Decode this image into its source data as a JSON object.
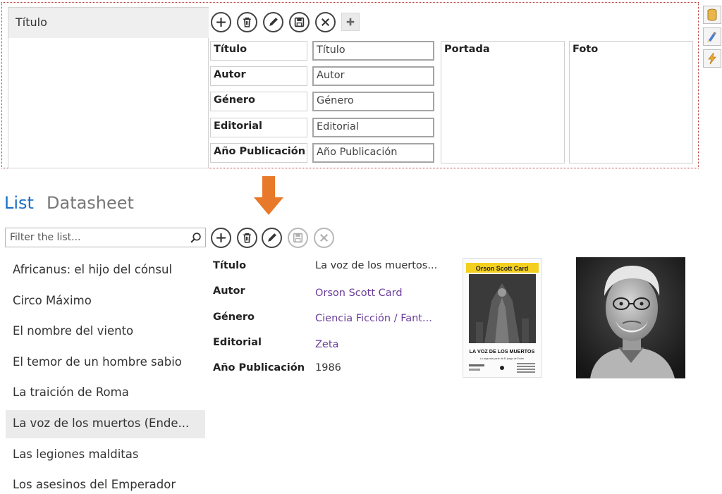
{
  "designer": {
    "title_column_header": "Título",
    "fields": [
      {
        "label": "Título",
        "placeholder": "Título"
      },
      {
        "label": "Autor",
        "placeholder": "Autor"
      },
      {
        "label": "Género",
        "placeholder": "Género"
      },
      {
        "label": "Editorial",
        "placeholder": "Editorial"
      },
      {
        "label": "Año Publicación",
        "placeholder": "Año Publicación"
      }
    ],
    "portada_label": "Portada",
    "foto_label": "Foto"
  },
  "view": {
    "tab_list": "List",
    "tab_datasheet": "Datasheet",
    "filter_placeholder": "Filter the list..."
  },
  "list": [
    "Africanus: el hijo del cónsul",
    "Circo Máximo",
    "El nombre del viento",
    "El temor de un hombre sabio",
    "La traición de Roma",
    "La voz de los muertos (Ende...",
    "Las legiones malditas",
    "Los asesinos del Emperador"
  ],
  "selected_index": 5,
  "record": {
    "fields": [
      {
        "label": "Título",
        "value": "La voz de los muertos..."
      },
      {
        "label": "Autor",
        "value": "Orson Scott Card"
      },
      {
        "label": "Género",
        "value": "Ciencia Ficción / Fant..."
      },
      {
        "label": "Editorial",
        "value": "Zeta"
      },
      {
        "label": "Año Publicación",
        "value": "1986"
      }
    ],
    "cover_author": "Orson Scott Card",
    "cover_title": "LA VOZ DE LOS MUERTOS",
    "cover_subtitle": "La segunda parte de El juego de Ender"
  },
  "colors": {
    "accent": "#1a6fc4",
    "link": "#6b3d9a",
    "arrow": "#e8782a",
    "designer_border": "#b83c3c"
  }
}
